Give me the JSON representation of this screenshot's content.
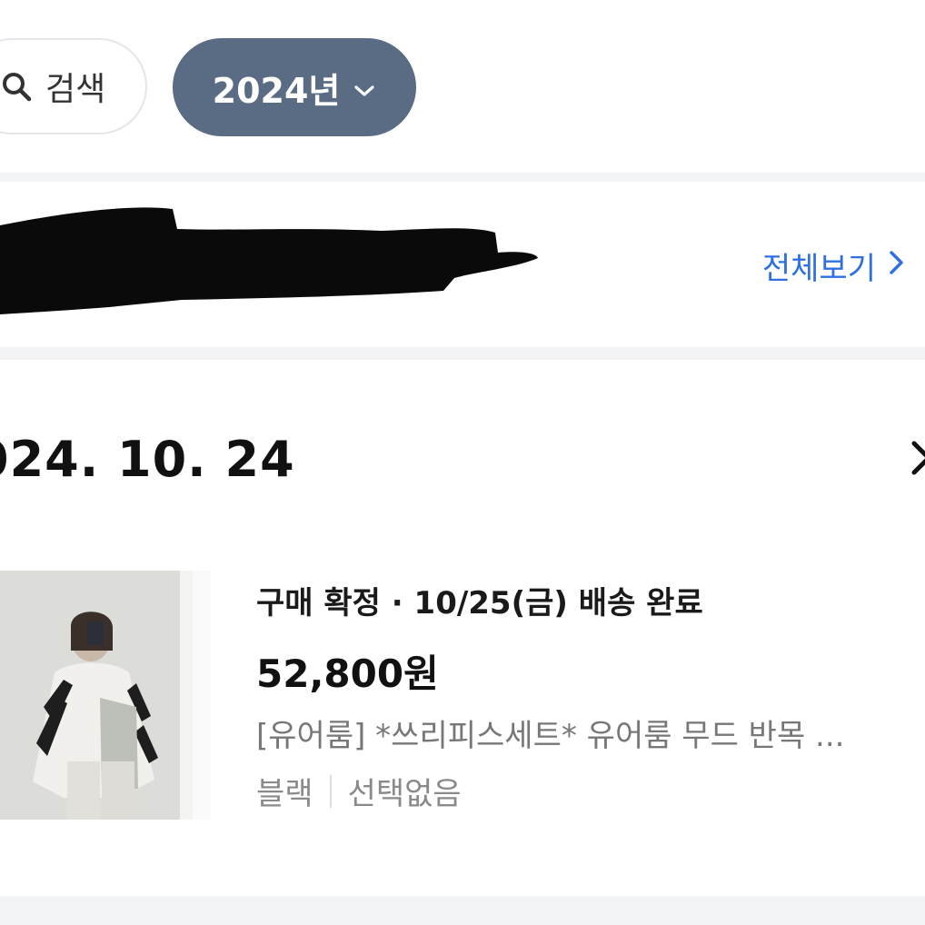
{
  "filter_bar": {
    "search_label": "검색",
    "year_label": "2024년",
    "search_icon": "search-icon",
    "year_icon": "chevron-down-icon"
  },
  "store_card": {
    "view_all_label": "전체보기",
    "view_all_icon": "chevron-right-icon",
    "accent_color": "#2f6fe0"
  },
  "order": {
    "date": "024. 10. 24",
    "date_icon": "chevron-right-icon",
    "status": "구매 확정 · 10/25(금) 배송 완료",
    "price": "52,800원",
    "product_name": "[유어룸] *쓰리피스세트* 유어룸 무드 반목 ...",
    "option_color": "블랙",
    "option_choice": "선택없음"
  },
  "colors": {
    "year_chip_bg": "#5a6b84",
    "section_gap": "#f2f3f5"
  }
}
